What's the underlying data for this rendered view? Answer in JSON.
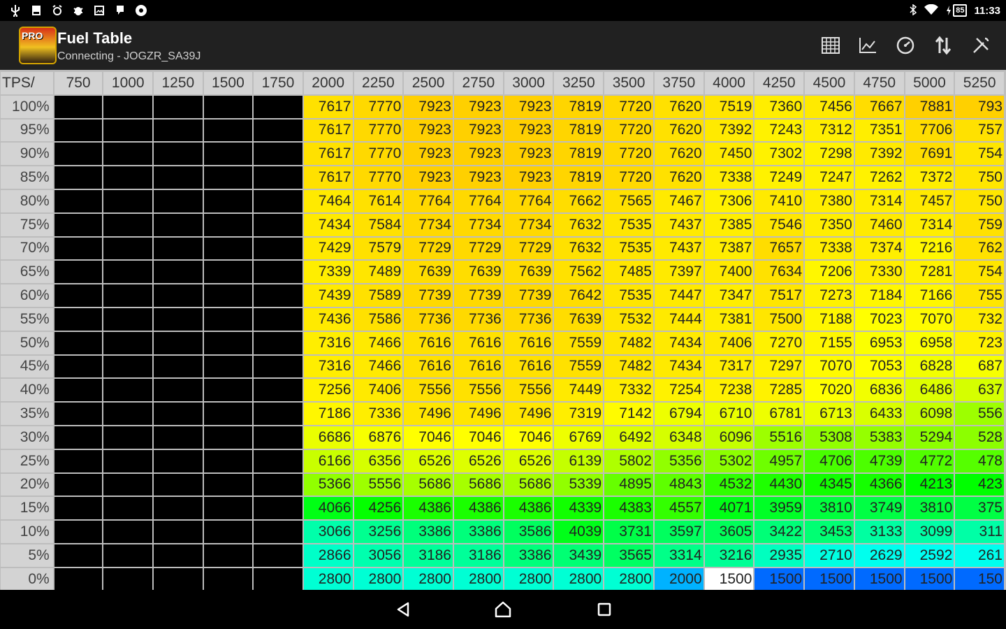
{
  "status_bar": {
    "time": "11:33",
    "battery": "85",
    "left_icons": [
      "usb-icon",
      "sd-card-icon",
      "alarm-icon",
      "bug-icon",
      "image-icon",
      "notification-icon",
      "settings-notification-icon"
    ]
  },
  "app_bar": {
    "logo_text": "PRO",
    "title": "Fuel Table",
    "subtitle": "Connecting - JOGZR_SA39J",
    "actions": [
      "table-icon",
      "chart-icon",
      "gauge-icon",
      "sort-icon",
      "tools-icon"
    ]
  },
  "table": {
    "corner_label": "TPS/",
    "columns": [
      "750",
      "1000",
      "1250",
      "1500",
      "1750",
      "2000",
      "2250",
      "2500",
      "2750",
      "3000",
      "3250",
      "3500",
      "3750",
      "4000",
      "4250",
      "4500",
      "4750",
      "5000",
      "5250"
    ],
    "rows": [
      {
        "label": "100%",
        "cells": [
          "",
          "",
          "",
          "",
          "",
          "7617",
          "7770",
          "7923",
          "7923",
          "7923",
          "7819",
          "7720",
          "7620",
          "7519",
          "7360",
          "7456",
          "7667",
          "7881",
          "793"
        ]
      },
      {
        "label": "95%",
        "cells": [
          "",
          "",
          "",
          "",
          "",
          "7617",
          "7770",
          "7923",
          "7923",
          "7923",
          "7819",
          "7720",
          "7620",
          "7392",
          "7243",
          "7312",
          "7351",
          "7706",
          "757"
        ]
      },
      {
        "label": "90%",
        "cells": [
          "",
          "",
          "",
          "",
          "",
          "7617",
          "7770",
          "7923",
          "7923",
          "7923",
          "7819",
          "7720",
          "7620",
          "7450",
          "7302",
          "7298",
          "7392",
          "7691",
          "754"
        ]
      },
      {
        "label": "85%",
        "cells": [
          "",
          "",
          "",
          "",
          "",
          "7617",
          "7770",
          "7923",
          "7923",
          "7923",
          "7819",
          "7720",
          "7620",
          "7338",
          "7249",
          "7247",
          "7262",
          "7372",
          "750"
        ]
      },
      {
        "label": "80%",
        "cells": [
          "",
          "",
          "",
          "",
          "",
          "7464",
          "7614",
          "7764",
          "7764",
          "7764",
          "7662",
          "7565",
          "7467",
          "7306",
          "7410",
          "7380",
          "7314",
          "7457",
          "750"
        ]
      },
      {
        "label": "75%",
        "cells": [
          "",
          "",
          "",
          "",
          "",
          "7434",
          "7584",
          "7734",
          "7734",
          "7734",
          "7632",
          "7535",
          "7437",
          "7385",
          "7546",
          "7350",
          "7460",
          "7314",
          "759"
        ]
      },
      {
        "label": "70%",
        "cells": [
          "",
          "",
          "",
          "",
          "",
          "7429",
          "7579",
          "7729",
          "7729",
          "7729",
          "7632",
          "7535",
          "7437",
          "7387",
          "7657",
          "7338",
          "7374",
          "7216",
          "762"
        ]
      },
      {
        "label": "65%",
        "cells": [
          "",
          "",
          "",
          "",
          "",
          "7339",
          "7489",
          "7639",
          "7639",
          "7639",
          "7562",
          "7485",
          "7397",
          "7400",
          "7634",
          "7206",
          "7330",
          "7281",
          "754"
        ]
      },
      {
        "label": "60%",
        "cells": [
          "",
          "",
          "",
          "",
          "",
          "7439",
          "7589",
          "7739",
          "7739",
          "7739",
          "7642",
          "7535",
          "7447",
          "7347",
          "7517",
          "7273",
          "7184",
          "7166",
          "755"
        ]
      },
      {
        "label": "55%",
        "cells": [
          "",
          "",
          "",
          "",
          "",
          "7436",
          "7586",
          "7736",
          "7736",
          "7736",
          "7639",
          "7532",
          "7444",
          "7381",
          "7500",
          "7188",
          "7023",
          "7070",
          "732"
        ]
      },
      {
        "label": "50%",
        "cells": [
          "",
          "",
          "",
          "",
          "",
          "7316",
          "7466",
          "7616",
          "7616",
          "7616",
          "7559",
          "7482",
          "7434",
          "7406",
          "7270",
          "7155",
          "6953",
          "6958",
          "723"
        ]
      },
      {
        "label": "45%",
        "cells": [
          "",
          "",
          "",
          "",
          "",
          "7316",
          "7466",
          "7616",
          "7616",
          "7616",
          "7559",
          "7482",
          "7434",
          "7317",
          "7297",
          "7070",
          "7053",
          "6828",
          "687"
        ]
      },
      {
        "label": "40%",
        "cells": [
          "",
          "",
          "",
          "",
          "",
          "7256",
          "7406",
          "7556",
          "7556",
          "7556",
          "7449",
          "7332",
          "7254",
          "7238",
          "7285",
          "7020",
          "6836",
          "6486",
          "637"
        ]
      },
      {
        "label": "35%",
        "cells": [
          "",
          "",
          "",
          "",
          "",
          "7186",
          "7336",
          "7496",
          "7496",
          "7496",
          "7319",
          "7142",
          "6794",
          "6710",
          "6781",
          "6713",
          "6433",
          "6098",
          "556"
        ]
      },
      {
        "label": "30%",
        "cells": [
          "",
          "",
          "",
          "",
          "",
          "6686",
          "6876",
          "7046",
          "7046",
          "7046",
          "6769",
          "6492",
          "6348",
          "6096",
          "5516",
          "5308",
          "5383",
          "5294",
          "528"
        ]
      },
      {
        "label": "25%",
        "cells": [
          "",
          "",
          "",
          "",
          "",
          "6166",
          "6356",
          "6526",
          "6526",
          "6526",
          "6139",
          "5802",
          "5356",
          "5302",
          "4957",
          "4706",
          "4739",
          "4772",
          "478"
        ]
      },
      {
        "label": "20%",
        "cells": [
          "",
          "",
          "",
          "",
          "",
          "5366",
          "5556",
          "5686",
          "5686",
          "5686",
          "5339",
          "4895",
          "4843",
          "4532",
          "4430",
          "4345",
          "4366",
          "4213",
          "423"
        ]
      },
      {
        "label": "15%",
        "cells": [
          "",
          "",
          "",
          "",
          "",
          "4066",
          "4256",
          "4386",
          "4386",
          "4386",
          "4339",
          "4383",
          "4557",
          "4071",
          "3959",
          "3810",
          "3749",
          "3810",
          "375"
        ]
      },
      {
        "label": "10%",
        "cells": [
          "",
          "",
          "",
          "",
          "",
          "3066",
          "3256",
          "3386",
          "3386",
          "3586",
          "4039",
          "3731",
          "3597",
          "3605",
          "3422",
          "3453",
          "3133",
          "3099",
          "311"
        ]
      },
      {
        "label": "5%",
        "cells": [
          "",
          "",
          "",
          "",
          "",
          "2866",
          "3056",
          "3186",
          "3186",
          "3386",
          "3439",
          "3565",
          "3314",
          "3216",
          "2935",
          "2710",
          "2629",
          "2592",
          "261"
        ]
      },
      {
        "label": "0%",
        "cells": [
          "",
          "",
          "",
          "",
          "",
          "2800",
          "2800",
          "2800",
          "2800",
          "2800",
          "2800",
          "2800",
          "2000",
          "1500",
          "1500",
          "1500",
          "1500",
          "1500",
          "150"
        ]
      }
    ],
    "special_cells": {
      "white_bg": [
        20,
        13
      ],
      "blue_bg_row0": "1500"
    },
    "colors": {
      "black_cell": "#000000",
      "header_bg": "#d3d3d3",
      "grid_line": "#bdbdbd",
      "selected_cell": "#ffffff"
    }
  },
  "nav_bar": {
    "buttons": [
      "back-icon",
      "home-icon",
      "recents-icon"
    ]
  }
}
